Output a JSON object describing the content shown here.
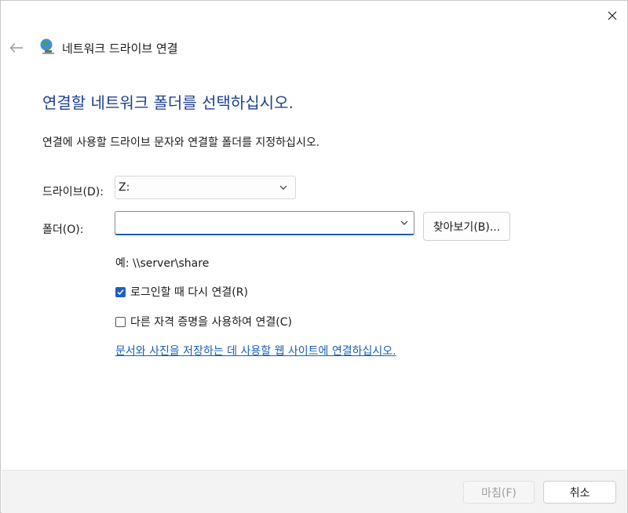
{
  "window": {
    "title": "네트워크 드라이브 연결"
  },
  "main": {
    "heading": "연결할 네트워크 폴더를 선택하십시오.",
    "description": "연결에 사용할 드라이브 문자와 연결할 폴더를 지정하십시오.",
    "drive_label": "드라이브(D):",
    "drive_value": "Z:",
    "folder_label": "폴더(O):",
    "folder_value": "",
    "folder_placeholder": "",
    "browse_label": "찾아보기(B)...",
    "example_text": "예: \\\\server\\share",
    "reconnect_label": "로그인할 때 다시 연결(R)",
    "reconnect_checked": true,
    "credentials_label": "다른 자격 증명을 사용하여 연결(C)",
    "credentials_checked": false,
    "link_text": "문서와 사진을 저장하는 데 사용할 웹 사이트에 연결하십시오."
  },
  "footer": {
    "finish_label": "마침(F)",
    "cancel_label": "취소"
  },
  "colors": {
    "accent": "#1f5fbf",
    "heading": "#1c3f94",
    "link": "#1a5fb4",
    "footer_bg": "#f3f3f3"
  },
  "icons": [
    "close-icon",
    "back-arrow-icon",
    "network-drive-icon",
    "chevron-down-icon",
    "checkmark-icon"
  ]
}
